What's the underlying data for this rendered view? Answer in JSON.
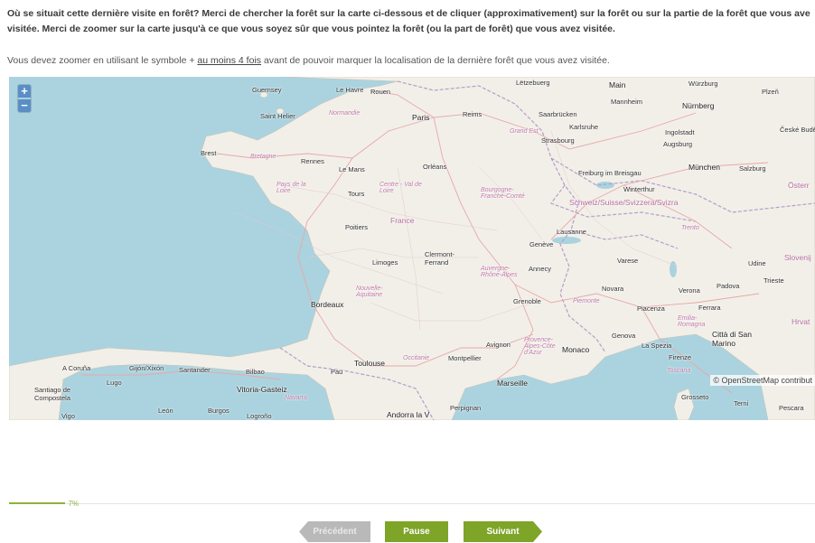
{
  "question": {
    "line1": "Où se situait cette dernière visite en forêt? Merci de chercher la forêt sur la carte ci-dessous et de cliquer (approximativement) sur la forêt ou sur la partie de la forêt que vous ave",
    "line2": "visitée. Merci de zoomer sur la carte jusqu'à ce que vous soyez sûr que vous pointez la forêt (ou la part de forêt) que vous avez visitée."
  },
  "instruction": {
    "before": "Vous devez zoomer en utilisant le symbole + ",
    "link": "au moins 4 fois",
    "after": " avant de pouvoir marquer la localisation de la dernière forêt que vous avez visitée."
  },
  "map": {
    "zoom_in": "+",
    "zoom_out": "−",
    "attribution": "© OpenStreetMap contribut",
    "labels": {
      "guernsey": "Guernsey",
      "le_havre": "Le Havre",
      "rouen": "Rouen",
      "saint_helier": "Saint Helier",
      "normandie": "Normandie",
      "paris": "Paris",
      "reims": "Reims",
      "luxembourg": "Lëtzebuerg",
      "main": "Main",
      "wurzburg": "Würzburg",
      "pilsen": "Plzeň",
      "mannheim": "Mannheim",
      "nurnberg": "Nürnberg",
      "saarbrucken": "Saarbrücken",
      "karlsruhe": "Karlsruhe",
      "grand_est": "Grand Est",
      "strasbourg": "Strasbourg",
      "ingolstadt": "Ingolstadt",
      "ceske": "České Budějovice",
      "augsburg": "Augsburg",
      "munchen": "München",
      "salzburg": "Salzburg",
      "brest": "Brest",
      "bretagne": "Bretagne",
      "rennes": "Rennes",
      "le_mans": "Le Mans",
      "orleans": "Orléans",
      "freiburg": "Freiburg im Breisgau",
      "winterthur": "Winterthur",
      "osterreich": "Österr",
      "pays_de_la_loire": "Pays de la Loire",
      "tours": "Tours",
      "centre": "Centre - Val de Loire",
      "bourgogne": "Bourgogne-Franche-Comté",
      "schweiz": "Schweiz/Suisse/Svizzera/Svizra",
      "france": "France",
      "poitiers": "Poitiers",
      "lausanne": "Lausanne",
      "trento": "Trento",
      "geneve": "Genève",
      "limoges": "Limoges",
      "clermont": "Clermont-Ferrand",
      "annecy": "Annecy",
      "varese": "Varese",
      "udine": "Udine",
      "slovenija": "Slovenij",
      "nouvelle_aquitaine": "Nouvelle-Aquitaine",
      "auvergne": "Auvergne-Rhône-Alpes",
      "trieste": "Trieste",
      "verona": "Verona",
      "padova": "Padova",
      "bordeaux": "Bordeaux",
      "grenoble": "Grenoble",
      "novara": "Novara",
      "piemonte": "Piemonte",
      "piacenza": "Piacenza",
      "ferrara": "Ferrara",
      "hrvat": "Hrvat",
      "emilia": "Emilia-Romagna",
      "genova": "Genova",
      "citta": "Città di San Marino",
      "avignon": "Avignon",
      "provence": "Provence-Alpes-Côte d'Azur",
      "monaco": "Monaco",
      "la_spezia": "La Spezia",
      "toulouse": "Toulouse",
      "occitanie": "Occitanie",
      "montpellier": "Montpellier",
      "firenze": "Firenze",
      "a_coruna": "A Coruña",
      "gijon": "Gijón/Xixón",
      "santander": "Santander",
      "bilbao": "Bilbao",
      "pau": "Pau",
      "marseille": "Marseille",
      "lugo": "Lugo",
      "vitoria": "Vitoria-Gasteiz",
      "santiago": "Santiago de Compostela",
      "navarra": "Navarra",
      "grosseto": "Grosseto",
      "terni": "Terni",
      "pescara": "Pescara",
      "leon": "León",
      "burgos": "Burgos",
      "perpignan": "Perpignan",
      "andorra": "Andorra la V",
      "vigo": "Vigo",
      "logrono": "Logroño",
      "toscana": "Toscana"
    }
  },
  "progress": {
    "value": 0.07,
    "label": "7%"
  },
  "nav": {
    "prev": "Précédent",
    "pause": "Pause",
    "next": "Suivant"
  },
  "colors": {
    "accent": "#7ea428",
    "disabled": "#b9b9b9",
    "sea": "#aad3df",
    "land": "#f2efe9",
    "border": "#b59ec9",
    "zoom": "#5a8ec7"
  }
}
